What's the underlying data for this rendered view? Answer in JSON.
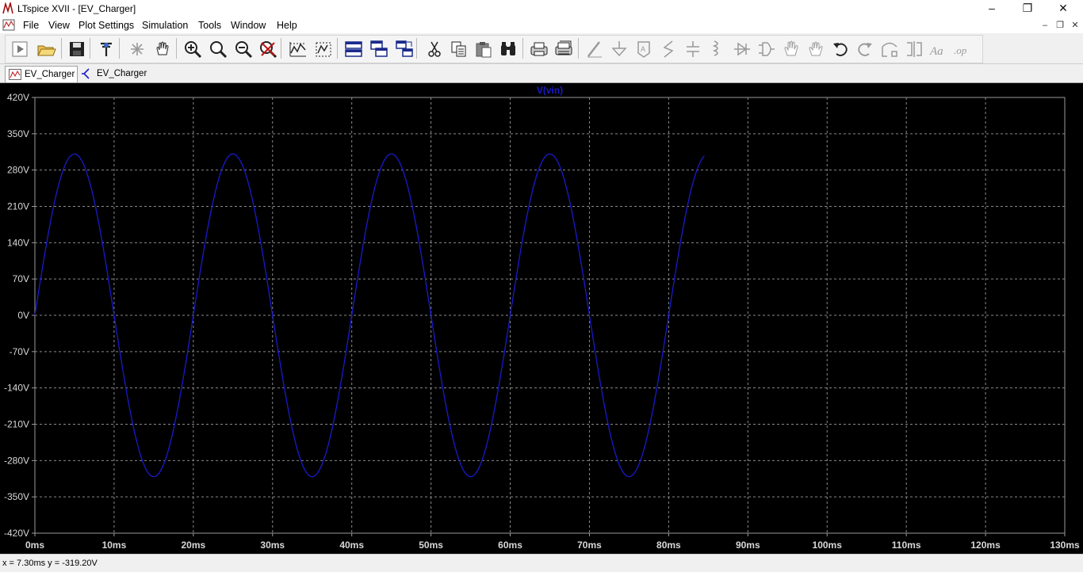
{
  "window": {
    "title": "LTspice XVII - [EV_Charger]"
  },
  "menu": [
    {
      "label": "File",
      "id": "file"
    },
    {
      "label": "View",
      "id": "view"
    },
    {
      "label": "Plot Settings",
      "id": "plot-settings"
    },
    {
      "label": "Simulation",
      "id": "simulation"
    },
    {
      "label": "Tools",
      "id": "tools"
    },
    {
      "label": "Window",
      "id": "window"
    },
    {
      "label": "Help",
      "id": "help"
    }
  ],
  "toolbar": [
    "run-icon",
    "open-icon",
    "save-icon",
    "control-panel-icon",
    "halt-icon",
    "pan-icon",
    "zoom-in-icon",
    "zoom-area-icon",
    "zoom-out-icon",
    "zoom-fit-icon",
    "autorange-icon",
    "autorange-y-icon",
    "tile-horizontal-icon",
    "cascade-icon",
    "tile-vertical-icon",
    "cut-icon",
    "copy-icon",
    "paste-icon",
    "find-icon",
    "print-icon",
    "print-setup-icon",
    "wire-icon",
    "ground-icon",
    "label-net-icon",
    "resistor-icon",
    "capacitor-icon",
    "inductor-icon",
    "diode-icon",
    "component-icon",
    "move-icon",
    "drag-icon",
    "undo-icon",
    "redo-icon",
    "rotate-icon",
    "mirror-icon",
    "text-icon",
    "spice-directive-icon"
  ],
  "tabs": [
    {
      "label": "EV_Charger",
      "kind": "waveform",
      "active": true
    },
    {
      "label": "EV_Charger",
      "kind": "schematic",
      "active": false
    }
  ],
  "chart_data": {
    "type": "line",
    "title": "V(vin)",
    "xlabel": "",
    "ylabel": "",
    "xlim": [
      0,
      0.13
    ],
    "ylim": [
      -420,
      420
    ],
    "x_ticks": [
      "0ms",
      "10ms",
      "20ms",
      "30ms",
      "40ms",
      "50ms",
      "60ms",
      "70ms",
      "80ms",
      "90ms",
      "100ms",
      "110ms",
      "120ms",
      "130ms"
    ],
    "y_ticks": [
      "420V",
      "350V",
      "280V",
      "210V",
      "140V",
      "70V",
      "0V",
      "-70V",
      "-140V",
      "-210V",
      "-280V",
      "-350V",
      "-420V"
    ],
    "grid": true,
    "series": [
      {
        "name": "V(vin)",
        "color": "#1a1acc",
        "amplitude_v": 311,
        "frequency_hz": 50,
        "x_start": 0,
        "x_end": 0.0845
      }
    ]
  },
  "status": {
    "text": "x = 7.30ms    y = -319.20V"
  },
  "colors": {
    "background": "#000000",
    "grid": "#8a8a8a",
    "trace": "#1a1acc",
    "axis_text": "#d8d8d8"
  }
}
